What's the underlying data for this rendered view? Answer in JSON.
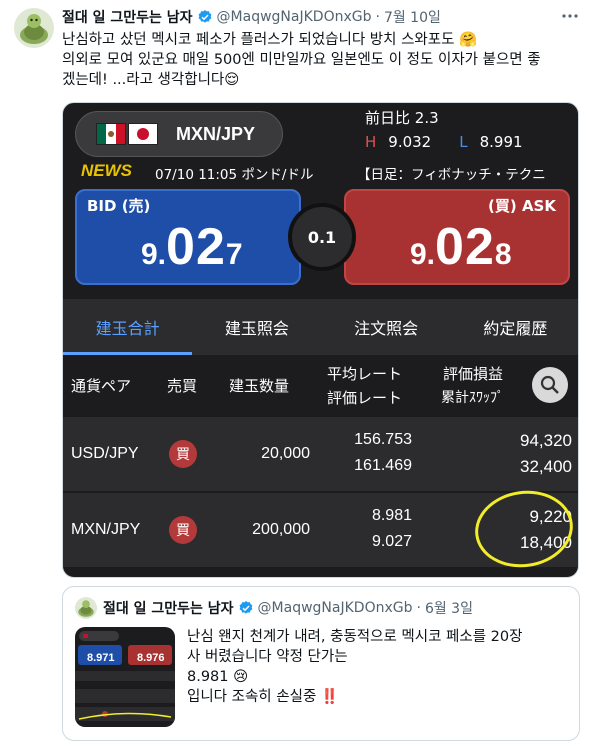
{
  "tweet": {
    "display_name": "절대 일 그만두는 남자",
    "handle": "@MaqwgNaJKDOnxGb",
    "dot": "·",
    "date": "7월 10일",
    "more_icon": "more-icon",
    "lines": [
      "난심하고 샀던 멕시코 페소가 플러스가 되었습니다 방치 스와포도 🤗",
      "의외로 모여 있군요 매일 500엔 미만일까요 일본엔도 이 정도 이자가 붙으면 좋",
      "겠는데! ...라고 생각합니다😌"
    ]
  },
  "app": {
    "pair": "MXN/JPY",
    "prev_label": "前日比",
    "prev_value": "2.3",
    "high_label": "H",
    "high_value": "9.032",
    "low_label": "L",
    "low_value": "8.991",
    "news_label": "NEWS",
    "news_text": "07/10 11:05 ポンド/ドル",
    "news_text2": "【日足：フィボナッチ・テクニ",
    "bid_label": "BID (売)",
    "ask_label": "(買) ASK",
    "bid_price": {
      "pre": "9.",
      "main": "02",
      "tail": "7"
    },
    "ask_price": {
      "pre": "9.",
      "main": "02",
      "tail": "8"
    },
    "spread": "0.1",
    "tabs": [
      "建玉合計",
      "建玉照会",
      "注文照会",
      "約定履歴"
    ],
    "headers": {
      "pair": "通貨ペア",
      "side": "売買",
      "qty": "建玉数量",
      "rate_top": "平均レート",
      "rate_bottom": "評価レート",
      "pl_top": "評価損益",
      "pl_bottom": "累計ｽﾜｯﾌﾟ"
    },
    "rows": [
      {
        "pair": "USD/JPY",
        "side": "買",
        "qty": "20,000",
        "avg": "156.753",
        "eval": "161.469",
        "pl": "94,320",
        "swap": "32,400"
      },
      {
        "pair": "MXN/JPY",
        "side": "買",
        "qty": "200,000",
        "avg": "8.981",
        "eval": "9.027",
        "pl": "9,220",
        "swap": "18,400"
      }
    ]
  },
  "quote": {
    "display_name": "절대 일 그만두는 남자",
    "handle": "@MaqwgNaJKDOnxGb",
    "dot": "·",
    "date": "6월 3일",
    "lines": [
      "난심 왠지 천계가 내려, 충동적으로 멕시코 페소를 20장",
      "사 버렸습니다 약정 단가는",
      "8.981 😢",
      "입니다 조속히 손실중 ‼️"
    ]
  },
  "colors": {
    "bid": "#1f4ea8",
    "ask": "#a83232",
    "tab_active": "#5aa0ff",
    "highlight_ring": "#f2ec2a",
    "verified": "#1d9bf0"
  }
}
